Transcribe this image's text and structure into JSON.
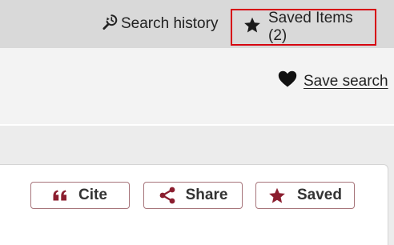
{
  "topbar": {
    "search_history_label": "Search history",
    "saved_items_label": "Saved Items (2)"
  },
  "search": {
    "save_search_label": "Save search"
  },
  "actions": {
    "cite_label": "Cite",
    "share_label": "Share",
    "saved_label": "Saved"
  },
  "colors": {
    "accent": "#8b1e2f",
    "highlight_border": "#d6000f"
  },
  "icons": {
    "history": "history-search-icon",
    "star": "star-icon",
    "heart": "heart-icon",
    "quote": "quote-icon",
    "share": "share-icon"
  }
}
